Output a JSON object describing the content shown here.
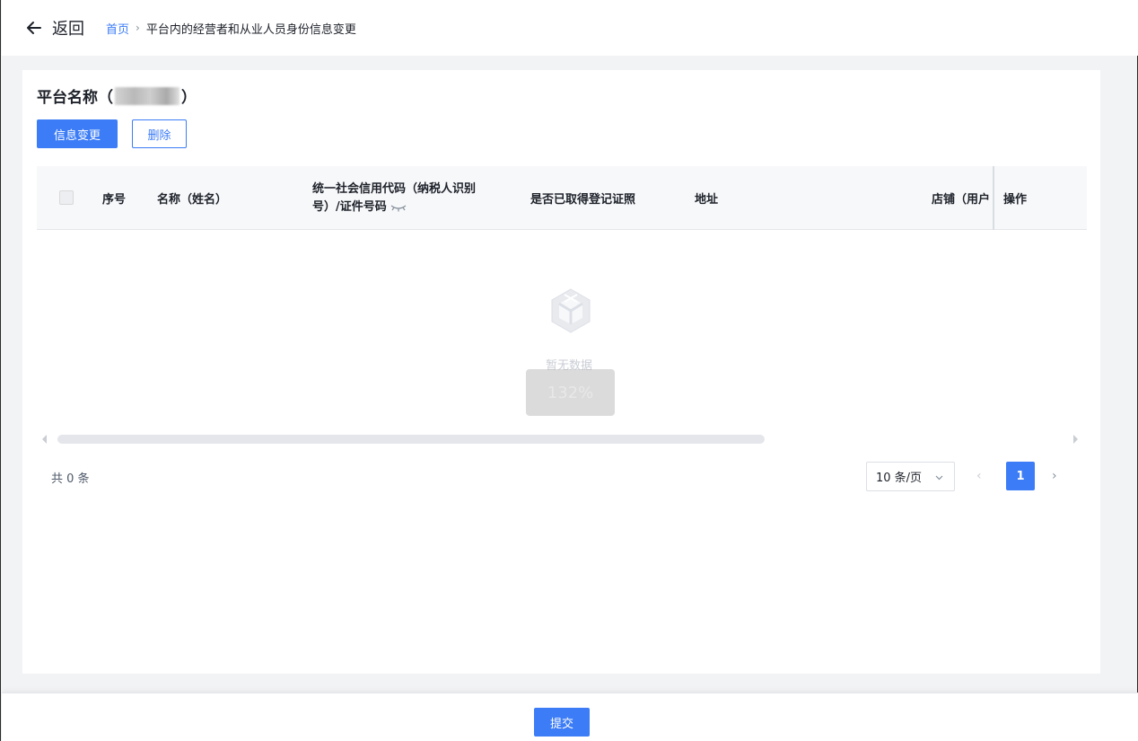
{
  "header": {
    "back_label": "返回",
    "breadcrumb": {
      "home": "首页",
      "separator": "›",
      "current": "平台内的经营者和从业人员身份信息变更"
    }
  },
  "card": {
    "title_prefix": "平台名称（",
    "title_suffix": "）",
    "buttons": {
      "change_label": "信息变更",
      "delete_label": "删除"
    },
    "table": {
      "columns": {
        "index": "序号",
        "name": "名称（姓名）",
        "code_line1": "统一社会信用代码（纳税人识别",
        "code_line2": "号）/证件号码",
        "license": "是否已取得登记证照",
        "address": "地址",
        "shop": "店铺（用户",
        "action": "操作"
      },
      "empty_text": "暂无数据",
      "zoom_badge": "132%"
    },
    "pagination": {
      "total": "共 0 条",
      "page_size": "10 条/页",
      "prev": "‹",
      "current_page": "1",
      "next": "›"
    }
  },
  "footer": {
    "submit_label": "提交"
  },
  "colors": {
    "primary": "#3c7cf6",
    "page_bg": "#f2f3f5",
    "table_header_bg": "#f7f8fa"
  },
  "icons": [
    "back-arrow-icon",
    "eye-closed-icon",
    "empty-box-icon",
    "chevron-down-icon"
  ]
}
